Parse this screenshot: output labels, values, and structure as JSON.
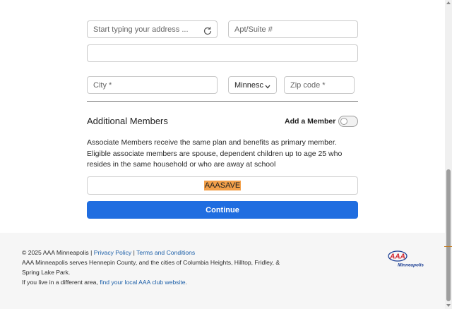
{
  "form": {
    "address_placeholder": "Start typing your address ...",
    "apt_placeholder": "Apt/Suite #",
    "address_line2_value": "",
    "city_placeholder": "City *",
    "state_value": "Minnesc",
    "zip_placeholder": "Zip code *"
  },
  "members": {
    "title": "Additional Members",
    "toggle_label": "Add a Member",
    "toggle_on": false,
    "description": "Associate Members receive the same plan and benefits as primary member. Eligible associate members are spouse, dependent children up to age 25 who resides in the same household or who are away at school"
  },
  "promo": {
    "code": "AAASAVE",
    "highlight_color": "#f3a04a"
  },
  "actions": {
    "continue_label": "Continue",
    "button_color": "#1f6de0"
  },
  "footer": {
    "copyright": "© 2025 AAA Minneapolis |",
    "privacy_link": "Privacy Policy",
    "separator": "|",
    "terms_link": "Terms and Conditions",
    "service_text": "AAA Minneapolis serves Hennepin County, and the cities of Columbia Heights, Hilltop, Fridley, & Spring Lake Park.",
    "different_area_text": "If you live in a different area,",
    "club_link": "find your local AAA club website",
    "period": ".",
    "logo_text": "AAA",
    "logo_subtext": "Minneapolis"
  }
}
